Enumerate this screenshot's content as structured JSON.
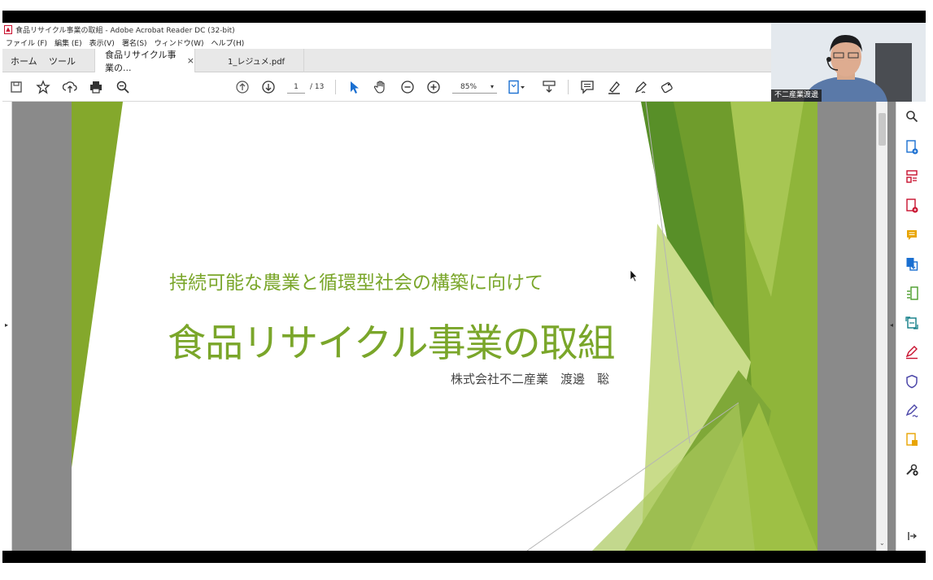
{
  "window": {
    "title": "食品リサイクル事業の取組 - Adobe Acrobat Reader DC (32-bit)"
  },
  "menu": [
    "ファイル (F)",
    "編集 (E)",
    "表示(V)",
    "署名(S)",
    "ウィンドウ(W)",
    "ヘルプ(H)"
  ],
  "tabs": {
    "home": "ホーム",
    "tools": "ツール",
    "active": "食品リサイクル事業の...",
    "close": "×",
    "second": "1_レジュメ.pdf"
  },
  "toolbar": {
    "page_current": "1",
    "page_total": "/ 13",
    "zoom": "85%",
    "zoom_caret": "▾"
  },
  "webcam": {
    "label": "不二産業渡邊"
  },
  "slide": {
    "subtitle": "持続可能な農業と循環型社会の構築に向けて",
    "title": "食品リサイクル事業の取組",
    "author": "株式会社不二産業　渡邊　聡"
  },
  "colors": {
    "accent_green": "#7aa62a",
    "dark_green": "#4e7d1e",
    "acrobat_red": "#c8102e",
    "tool_blue": "#1a6fd1"
  },
  "icons": {
    "left_panel_toggle": "▸",
    "right_panel_toggle": "◂",
    "scroll_down": "⌄"
  }
}
